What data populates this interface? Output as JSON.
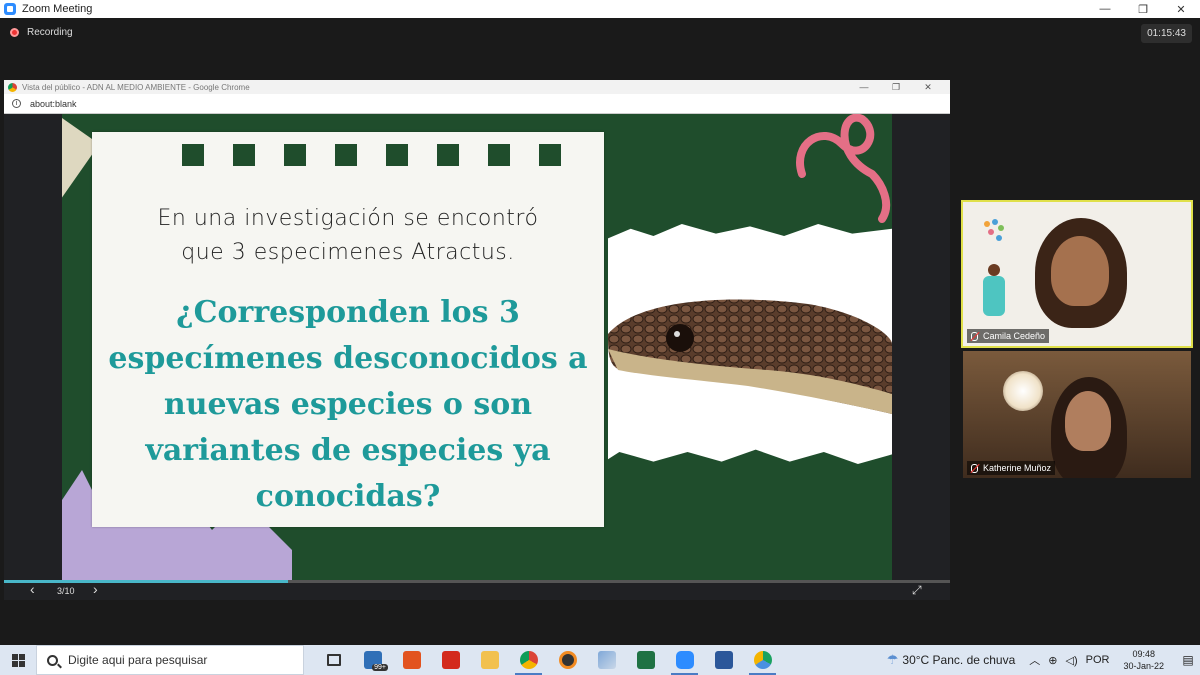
{
  "zoom": {
    "title": "Zoom Meeting",
    "recording_label": "Recording",
    "timer": "01:15:43",
    "win_minimize": "—",
    "win_restore": "❐",
    "win_close": "✕"
  },
  "chrome": {
    "title": "Vista del público - ADN AL MEDIO AMBIENTE - Google Chrome",
    "url": "about:blank",
    "minimize": "—",
    "restore": "❐",
    "close": "✕"
  },
  "slide": {
    "intro_line1": "En una investigación se encontró",
    "intro_line2": "que 3 especimenes Atractus.",
    "question_lines": [
      "¿Corresponden los 3",
      "especímenes desconocidos a",
      "nuevas especies o son",
      "variantes de especies ya",
      "conocidas?"
    ],
    "counter": "3/10",
    "progress": 0.3,
    "prev_icon": "‹",
    "next_icon": "›",
    "fullscreen_icon": "⤢"
  },
  "participants": [
    {
      "name": "Camila Cedeño",
      "muted": true
    },
    {
      "name": "Katherine Muñoz",
      "muted": true
    }
  ],
  "taskbar": {
    "search_placeholder": "Digite aqui para pesquisar",
    "mail_badge": "99+",
    "weather": "30°C  Panc. de chuva",
    "language": "POR",
    "time": "09:48",
    "date": "30-Jan-22"
  },
  "colors": {
    "slide_bg": "#1f4d2c",
    "question_text": "#1e9a9a",
    "active_speaker_border": "#e0e04a",
    "progress": "#49b7c9"
  },
  "icons": {
    "taskbar_apps": [
      "task-view-icon",
      "mail-icon",
      "office-icon",
      "acrobat-icon",
      "file-explorer-icon",
      "chrome-icon",
      "app-icon",
      "pencil-app-icon",
      "excel-icon",
      "zoom-icon",
      "word-icon",
      "chrome-icon-2"
    ]
  }
}
